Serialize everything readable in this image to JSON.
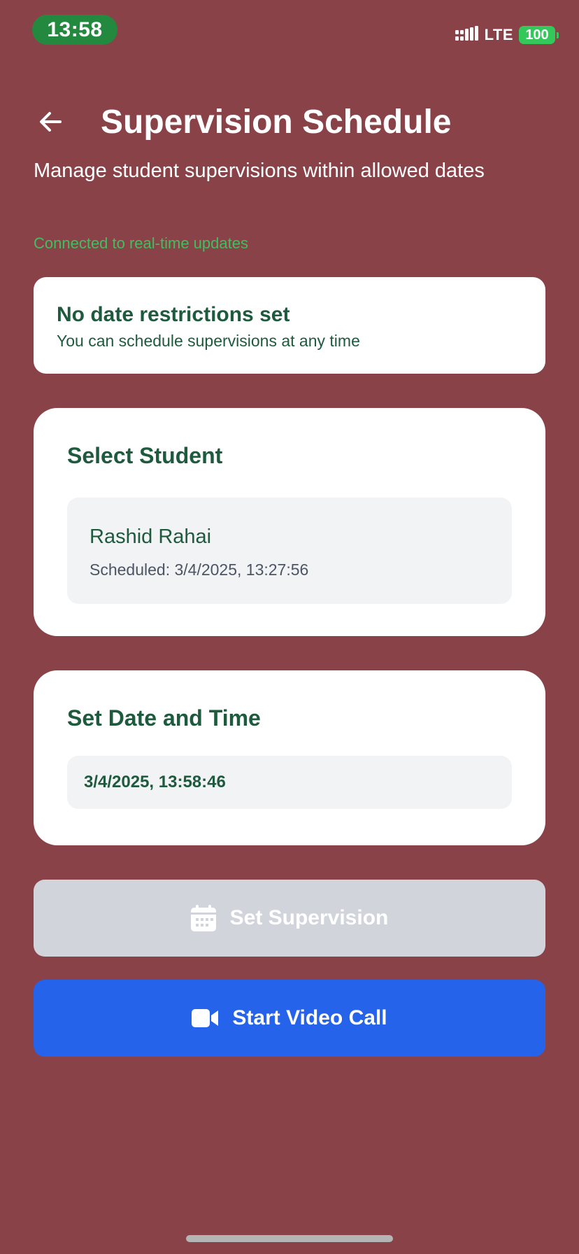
{
  "status_bar": {
    "time": "13:58",
    "network": "LTE",
    "battery": "100",
    "icons": [
      "signal-icon",
      "battery-icon"
    ]
  },
  "header": {
    "title": "Supervision Schedule",
    "subtitle": "Manage student supervisions within allowed dates",
    "back_icon": "arrow-left-icon"
  },
  "connection": {
    "status": "Connected to real-time updates"
  },
  "restrictions": {
    "title": "No date restrictions set",
    "text": "You can schedule supervisions at any time"
  },
  "student_section": {
    "title": "Select Student",
    "students": [
      {
        "name": "Rashid Rahai",
        "scheduled": "Scheduled: 3/4/2025, 13:27:56"
      }
    ]
  },
  "datetime_section": {
    "title": "Set Date and Time",
    "value": "3/4/2025, 13:58:46"
  },
  "actions": {
    "set_supervision": {
      "label": "Set Supervision",
      "icon": "calendar-icon",
      "state": "disabled"
    },
    "video_call": {
      "label": "Start Video Call",
      "icon": "video-camera-icon"
    }
  },
  "colors": {
    "background": "#8a4249",
    "accent_green": "#1e5a3d",
    "connected_green": "#3fbf5f",
    "time_pill": "#23893f",
    "primary_blue": "#2563eb",
    "disabled_gray": "#d1d5db"
  }
}
